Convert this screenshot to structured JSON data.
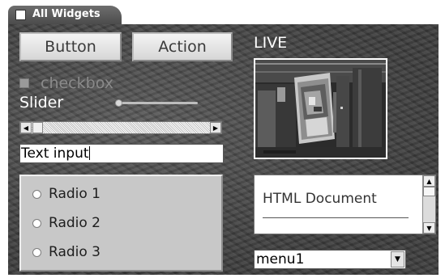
{
  "window": {
    "tab_label": "All Widgets"
  },
  "buttons": {
    "button_label": "Button",
    "action_label": "Action"
  },
  "checkbox": {
    "label": "checkbox",
    "checked": false,
    "enabled": false
  },
  "slider": {
    "label": "Slider",
    "value_fraction": 0.0
  },
  "scrollbar": {
    "left_arrow_icon": "arrow-left-icon",
    "right_arrow_icon": "arrow-right-icon",
    "value_fraction": 0.0
  },
  "text_input": {
    "value": "Text input"
  },
  "radio_group": {
    "options": [
      {
        "label": "Radio 1",
        "selected": false
      },
      {
        "label": "Radio 2",
        "selected": false
      },
      {
        "label": "Radio 3",
        "selected": false
      }
    ]
  },
  "live_view": {
    "label": "LIVE"
  },
  "html_document": {
    "title": "HTML Document",
    "scroll_up_icon": "arrow-up-icon",
    "scroll_down_icon": "arrow-down-icon"
  },
  "menu": {
    "selected": "menu1",
    "dropdown_icon": "chevron-down-icon"
  },
  "colors": {
    "panel_background": "#4e4e4e",
    "tab_background": "#5a5a5a",
    "label_text": "#ffffff",
    "disabled_text": "#8a8a8a",
    "radio_group_background": "#c8c8c8"
  }
}
